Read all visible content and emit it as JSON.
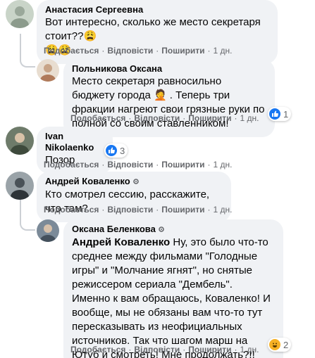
{
  "comments": [
    {
      "author": "Анастасия Сергеевна",
      "text": "Вот интересно, сколько же место секретаря стоит??😩",
      "emoji_line": "😩😩",
      "actions": {
        "like": "Подобається",
        "reply": "Відповісти",
        "share": "Поширити",
        "time": "1 дн."
      }
    },
    {
      "author": "Польникова Оксана",
      "text": "Место секретаря равносильно бюджету города 🤦 . Теперь три фракции нагреют свои грязные руки по полной со своим ставленником!",
      "reaction_count": "1",
      "actions": {
        "like": "Подобається",
        "reply": "Відповісти",
        "share": "Поширити",
        "time": "1 дн."
      }
    },
    {
      "author": "Ivan Nikolaenko",
      "text": "Позор",
      "reaction_count": "3",
      "actions": {
        "like": "Подобається",
        "reply": "Відповісти",
        "share": "Поширити",
        "time": "1 дн."
      }
    },
    {
      "author": "Андрей Коваленко",
      "text": "Кто смотрел сессию, расскажите, что там?",
      "actions": {
        "like": "Подобається",
        "reply": "Відповісти",
        "share": "Поширити",
        "time": "1 дн."
      }
    },
    {
      "author": "Оксана Беленкова",
      "mention": "Андрей Коваленко",
      "text": " Ну, это было что-то среднее между фильмами \"Голодные игры\" и \"Молчание ягнят\", но снятые режиссером сериала \"Дембель\".\nИменно к вам обращаюсь, Коваленко! И вообще, мы не обязаны вам что-то тут пересказывать из неофициальных источников. Так что шагом марш на Ютуб и смотреть! Мне продолжать?!!",
      "reaction_count": "2",
      "actions": {
        "like": "Подобається",
        "reply": "Відповісти",
        "share": "Поширити",
        "time": "1 дн."
      }
    }
  ],
  "colors": {
    "bubble": "#f0f2f5",
    "meta": "#65676b",
    "like": "#1877f2",
    "haha": "#f7b125"
  }
}
